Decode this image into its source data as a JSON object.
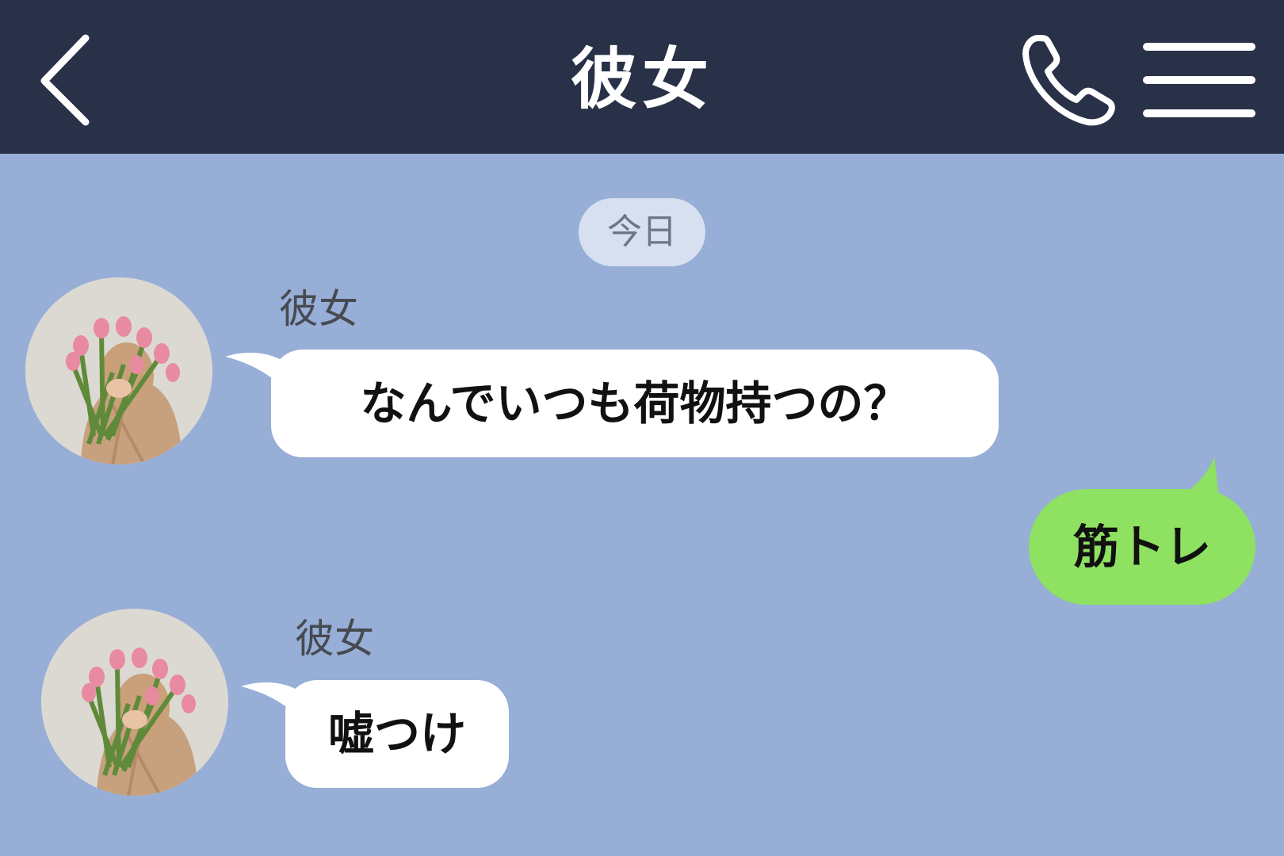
{
  "header": {
    "title": "彼女",
    "back_icon": "chevron-left-icon",
    "call_icon": "phone-icon",
    "menu_icon": "hamburger-menu-icon",
    "background": "#283147"
  },
  "chat": {
    "background": "#97aed7",
    "date_label": "今日",
    "messages": [
      {
        "side": "in",
        "sender": "彼女",
        "text": "なんでいつも荷物持つの？"
      },
      {
        "side": "out",
        "text": "筋トレ"
      },
      {
        "side": "in",
        "sender": "彼女",
        "text": "嘘つけ"
      }
    ],
    "incoming_bubble_color": "#ffffff",
    "outgoing_bubble_color": "#8ee161"
  }
}
